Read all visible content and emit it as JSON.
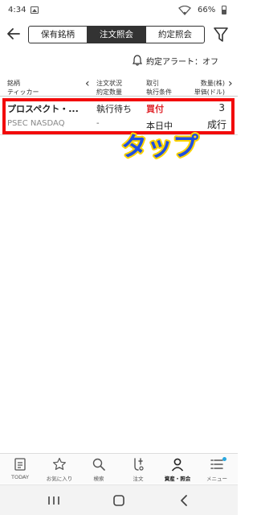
{
  "status_bar": {
    "time": "4:34",
    "battery": "66%"
  },
  "nav": {
    "tabs": [
      {
        "label": "保有銘柄",
        "active": false
      },
      {
        "label": "注文照会",
        "active": true
      },
      {
        "label": "約定照会",
        "active": false
      }
    ]
  },
  "alert": {
    "label": "約定アラート：オフ"
  },
  "table_header": {
    "col1_line1": "銘柄",
    "col1_line2": "ティッカー",
    "col2_line1": "注文状況",
    "col2_line2": "約定数量",
    "col3_line1": "取引",
    "col3_line2": "執行条件",
    "col4_line1": "数量(株)",
    "col4_line2": "単価(ドル)"
  },
  "order": {
    "name": "プロスペクト・...",
    "ticker": "PSEC NASDAQ",
    "status": "執行待ち",
    "filled": "-",
    "side": "買付",
    "condition": "本日中",
    "quantity": "3",
    "price_type": "成行"
  },
  "annotation": {
    "tap_text": "タップ"
  },
  "bottom_nav": {
    "items": [
      {
        "label": "TODAY",
        "icon": "today-icon"
      },
      {
        "label": "お気に入り",
        "icon": "star-icon"
      },
      {
        "label": "検索",
        "icon": "search-icon"
      },
      {
        "label": "注文",
        "icon": "order-icon"
      },
      {
        "label": "資産・照会",
        "icon": "person-icon"
      },
      {
        "label": "メニュー",
        "icon": "menu-icon"
      }
    ]
  },
  "colors": {
    "accent_red": "#e0262c",
    "highlight": "#f20a0a",
    "tap_fill": "#1f4fe0",
    "tap_outline": "#ffd400"
  }
}
